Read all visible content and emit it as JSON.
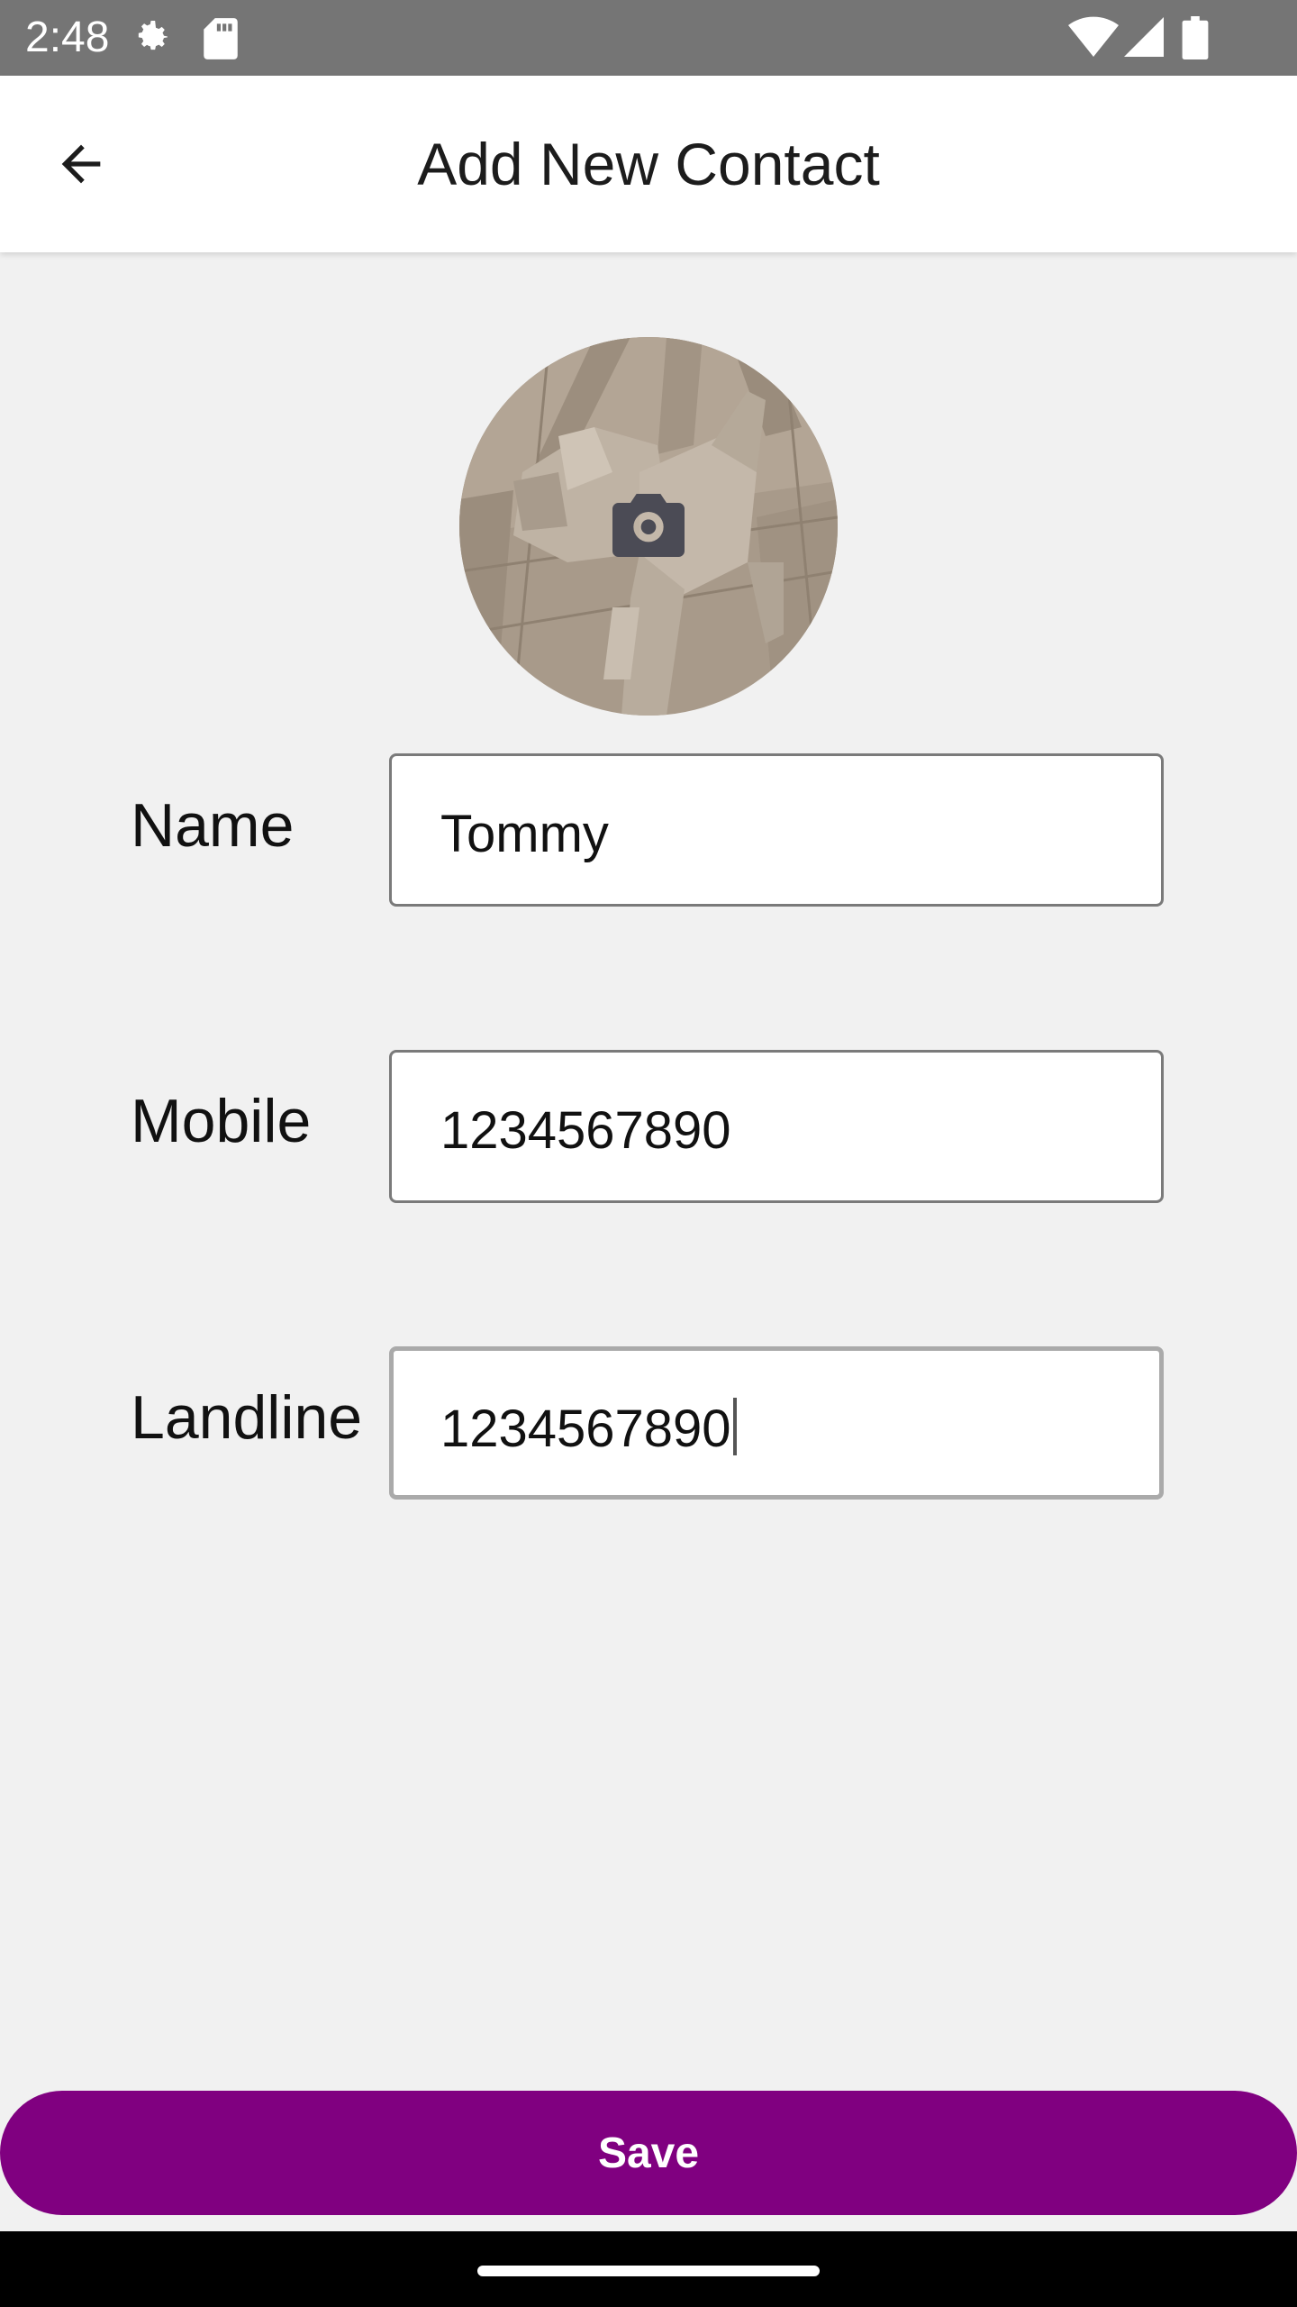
{
  "status_bar": {
    "time": "2:48",
    "icons": [
      "settings-gear-icon",
      "sd-card-icon",
      "wifi-icon",
      "cellular-signal-icon",
      "battery-icon"
    ]
  },
  "header": {
    "title": "Add New Contact",
    "back_icon": "arrow-back-icon"
  },
  "avatar": {
    "description_icon": "camera-icon"
  },
  "form": {
    "name": {
      "label": "Name",
      "value": "Tommy"
    },
    "mobile": {
      "label": "Mobile",
      "value": "1234567890"
    },
    "landline": {
      "label": "Landline",
      "value": "1234567890"
    }
  },
  "actions": {
    "save_label": "Save"
  },
  "colors": {
    "status_bar": "#757575",
    "accent": "#800080",
    "background": "#f1f1f1",
    "app_bar": "#ffffff"
  }
}
